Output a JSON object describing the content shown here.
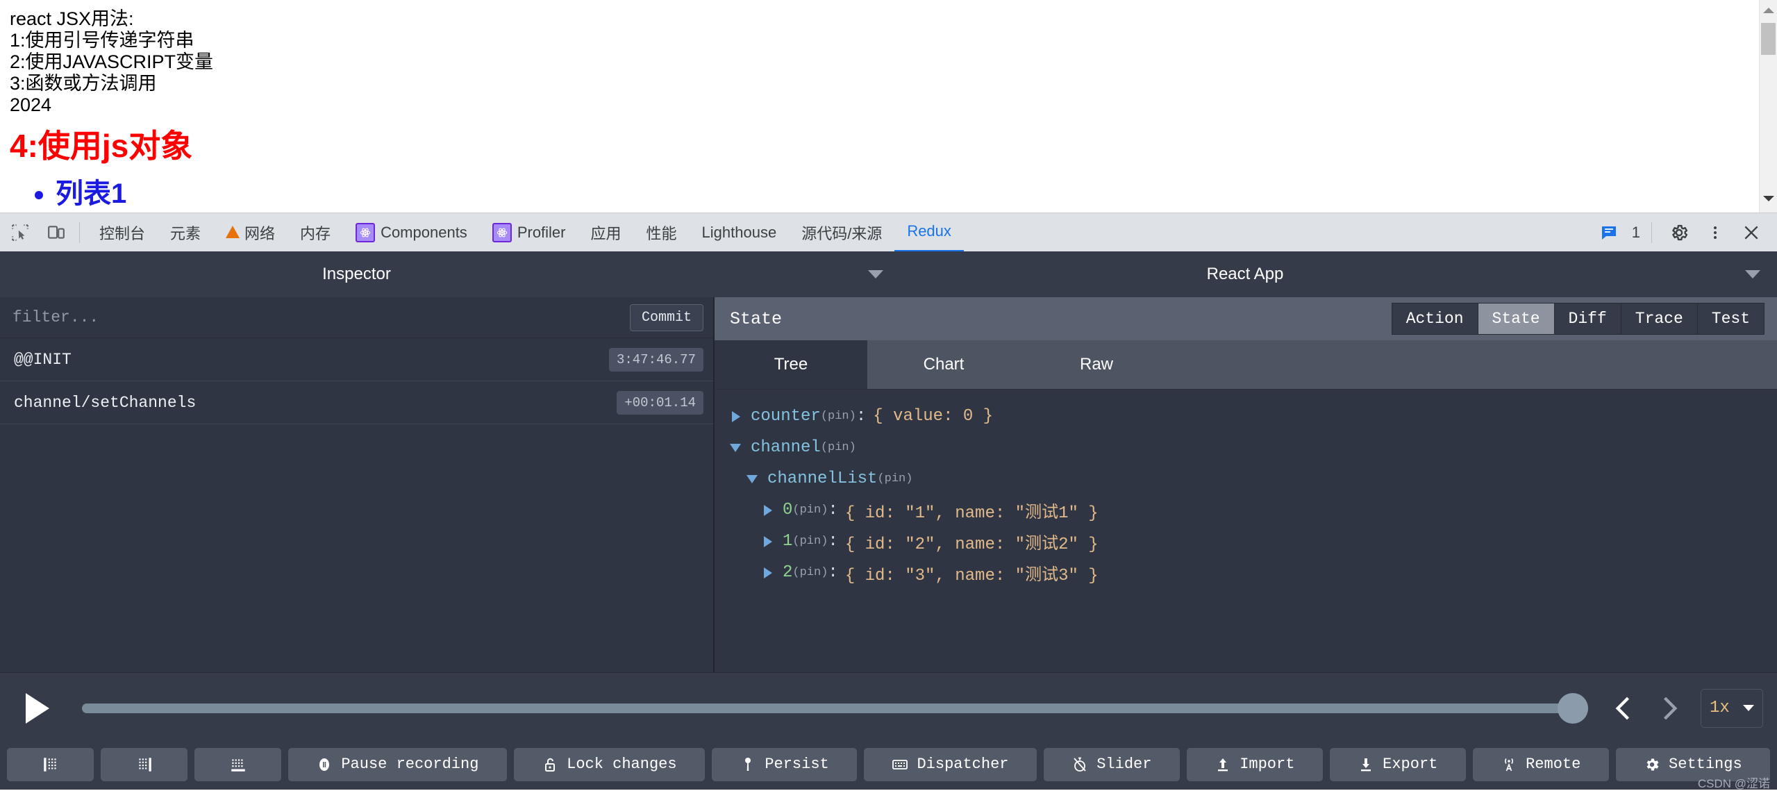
{
  "page": {
    "lines": [
      "react JSX用法:",
      "1:使用引号传递字符串",
      "2:使用JAVASCRIPT变量",
      "3:函数或方法调用",
      "2024"
    ],
    "heading": "4:使用js对象",
    "list_items": [
      "列表1"
    ]
  },
  "devtools": {
    "tabs": [
      {
        "label": "控制台",
        "icon": "none",
        "active": false
      },
      {
        "label": "元素",
        "icon": "none",
        "active": false
      },
      {
        "label": "网络",
        "icon": "warning-triangle",
        "active": false
      },
      {
        "label": "内存",
        "icon": "none",
        "active": false
      },
      {
        "label": "Components",
        "icon": "react-logo",
        "active": false
      },
      {
        "label": "Profiler",
        "icon": "react-logo",
        "active": false
      },
      {
        "label": "应用",
        "icon": "none",
        "active": false
      },
      {
        "label": "性能",
        "icon": "none",
        "active": false
      },
      {
        "label": "Lighthouse",
        "icon": "none",
        "active": false
      },
      {
        "label": "源代码/来源",
        "icon": "none",
        "active": false
      },
      {
        "label": "Redux",
        "icon": "none",
        "active": true
      }
    ],
    "left_icons": [
      "inspect-element-icon",
      "device-toolbar-icon"
    ],
    "message_count": "1",
    "right_icons": [
      "settings-gear-icon",
      "more-vertical-icon",
      "close-icon"
    ],
    "accent": "#1a73e8"
  },
  "redux": {
    "header": {
      "inspector_title": "Inspector",
      "instance_title": "React App"
    },
    "filter": {
      "placeholder": "filter...",
      "value": ""
    },
    "commit_label": "Commit",
    "actions": [
      {
        "name": "@@INIT",
        "time": "3:47:46.77"
      },
      {
        "name": "channel/setChannels",
        "time": "+00:01.14"
      }
    ],
    "state_panel": {
      "title": "State",
      "tabs": [
        {
          "label": "Action",
          "active": false
        },
        {
          "label": "State",
          "active": true
        },
        {
          "label": "Diff",
          "active": false
        },
        {
          "label": "Trace",
          "active": false
        },
        {
          "label": "Test",
          "active": false
        }
      ],
      "subtabs": [
        {
          "label": "Tree",
          "active": true
        },
        {
          "label": "Chart",
          "active": false
        },
        {
          "label": "Raw",
          "active": false
        }
      ]
    },
    "tree": [
      {
        "indent": 0,
        "arrow": "closed",
        "key": "counter",
        "key_kind": "name",
        "pin": "(pin)",
        "colon": ":",
        "preview": "{ value: 0 }"
      },
      {
        "indent": 0,
        "arrow": "open",
        "key": "channel",
        "key_kind": "name",
        "pin": "(pin)",
        "colon": "",
        "preview": ""
      },
      {
        "indent": 1,
        "arrow": "open",
        "key": "channelList",
        "key_kind": "name",
        "pin": "(pin)",
        "colon": "",
        "preview": ""
      },
      {
        "indent": 2,
        "arrow": "closed",
        "key": "0",
        "key_kind": "index",
        "pin": "(pin)",
        "colon": ":",
        "preview": "{ id: \"1\", name: \"测试1\" }"
      },
      {
        "indent": 2,
        "arrow": "closed",
        "key": "1",
        "key_kind": "index",
        "pin": "(pin)",
        "colon": ":",
        "preview": "{ id: \"2\", name: \"测试2\" }"
      },
      {
        "indent": 2,
        "arrow": "closed",
        "key": "2",
        "key_kind": "index",
        "pin": "(pin)",
        "colon": ":",
        "preview": "{ id: \"3\", name: \"测试3\" }"
      }
    ],
    "playback": {
      "play_icon": "play-icon",
      "slider_position_percent": 100,
      "prev_label": "prev-action-icon",
      "next_label": "next-action-icon",
      "speed": "1x"
    },
    "bottom_buttons": [
      {
        "label": "",
        "icon": "dock-left-icon"
      },
      {
        "label": "",
        "icon": "dock-right-icon"
      },
      {
        "label": "",
        "icon": "dock-bottom-icon"
      },
      {
        "label": "Pause recording",
        "icon": "pause-circle-icon"
      },
      {
        "label": "Lock changes",
        "icon": "lock-icon"
      },
      {
        "label": "Persist",
        "icon": "pin-icon"
      },
      {
        "label": "Dispatcher",
        "icon": "keyboard-icon"
      },
      {
        "label": "Slider",
        "icon": "stopwatch-off-icon"
      },
      {
        "label": "Import",
        "icon": "upload-icon"
      },
      {
        "label": "Export",
        "icon": "download-icon"
      },
      {
        "label": "Remote",
        "icon": "broadcast-icon"
      },
      {
        "label": "Settings",
        "icon": "gear-icon"
      }
    ],
    "watermark": "CSDN @涩诺"
  }
}
